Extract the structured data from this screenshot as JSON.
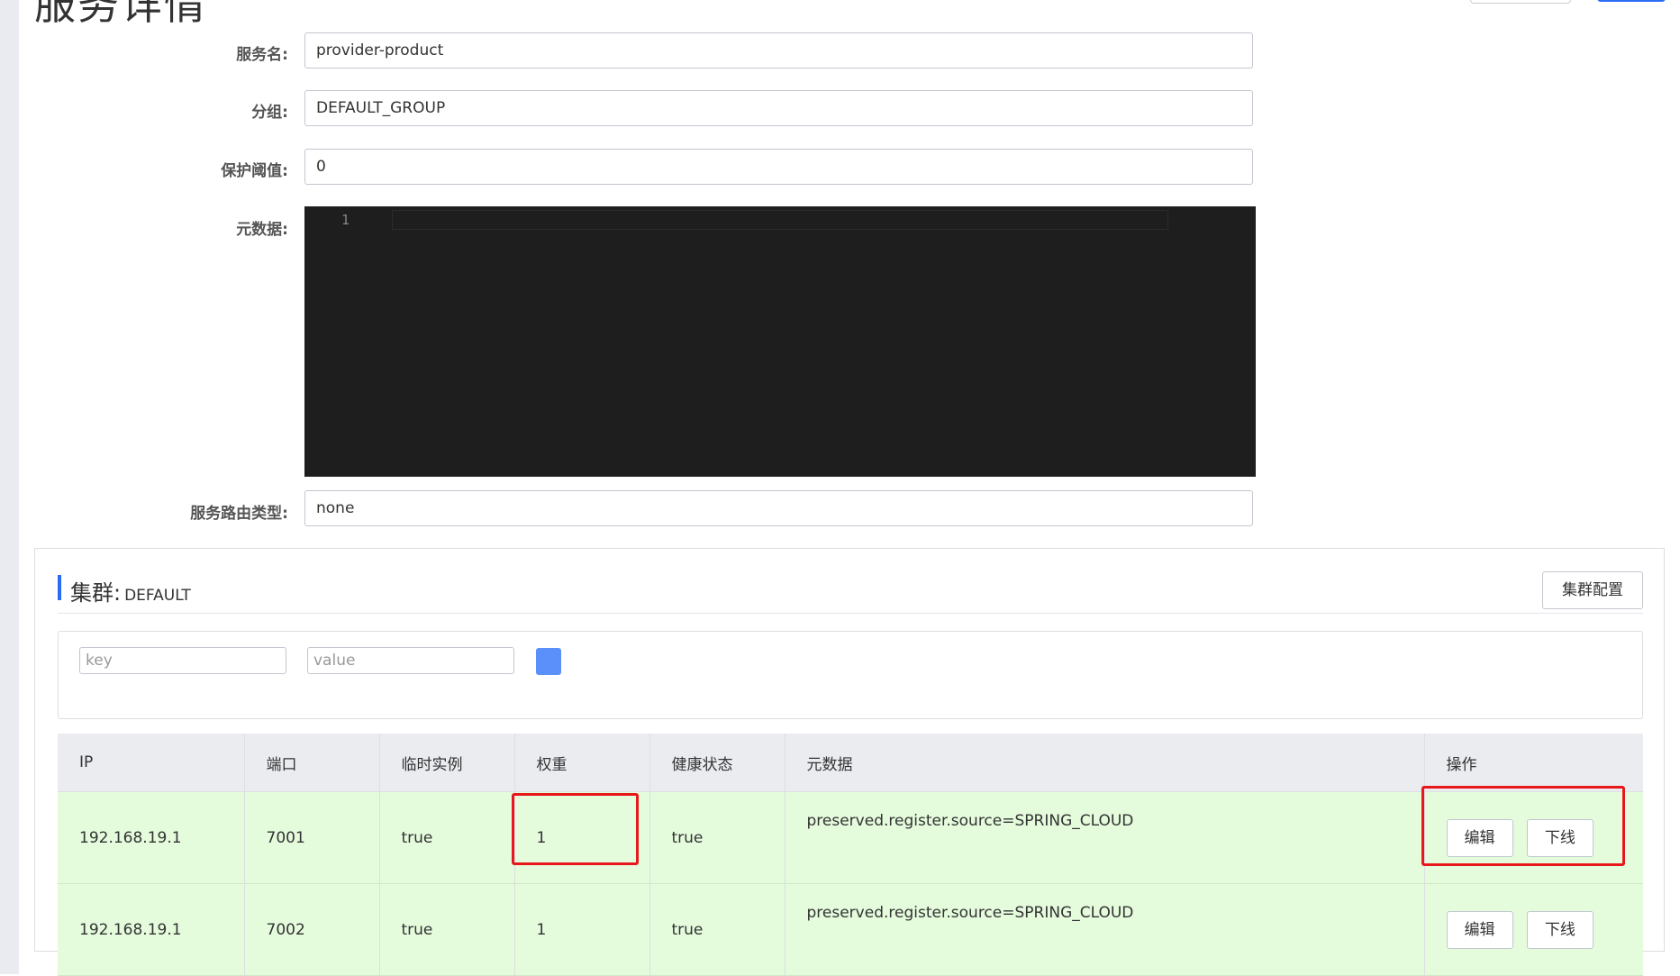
{
  "page": {
    "title": "服务详情"
  },
  "form": {
    "service_name_label": "服务名:",
    "service_name_value": "provider-product",
    "group_label": "分组:",
    "group_value": "DEFAULT_GROUP",
    "protect_threshold_label": "保护阈值:",
    "protect_threshold_value": "0",
    "metadata_label": "元数据:",
    "metadata_line_number": "1",
    "route_type_label": "服务路由类型:",
    "route_type_value": "none"
  },
  "cluster": {
    "label": "集群:",
    "name": "DEFAULT",
    "config_button": "集群配置",
    "filter": {
      "key_placeholder": "key",
      "value_placeholder": "value"
    }
  },
  "table": {
    "columns": [
      "IP",
      "端口",
      "临时实例",
      "权重",
      "健康状态",
      "元数据",
      "操作"
    ],
    "rows": [
      {
        "ip": "192.168.19.1",
        "port": "7001",
        "ephemeral": "true",
        "weight": "1",
        "healthy": "true",
        "metadata": "preserved.register.source=SPRING_CLOUD",
        "edit": "编辑",
        "offline": "下线"
      },
      {
        "ip": "192.168.19.1",
        "port": "7002",
        "ephemeral": "true",
        "weight": "1",
        "healthy": "true",
        "metadata": "preserved.register.source=SPRING_CLOUD",
        "edit": "编辑",
        "offline": "下线"
      }
    ]
  },
  "colors": {
    "accent": "#2a6cf5",
    "row_bg": "#e4fbdc",
    "highlight": "#e8171c"
  }
}
